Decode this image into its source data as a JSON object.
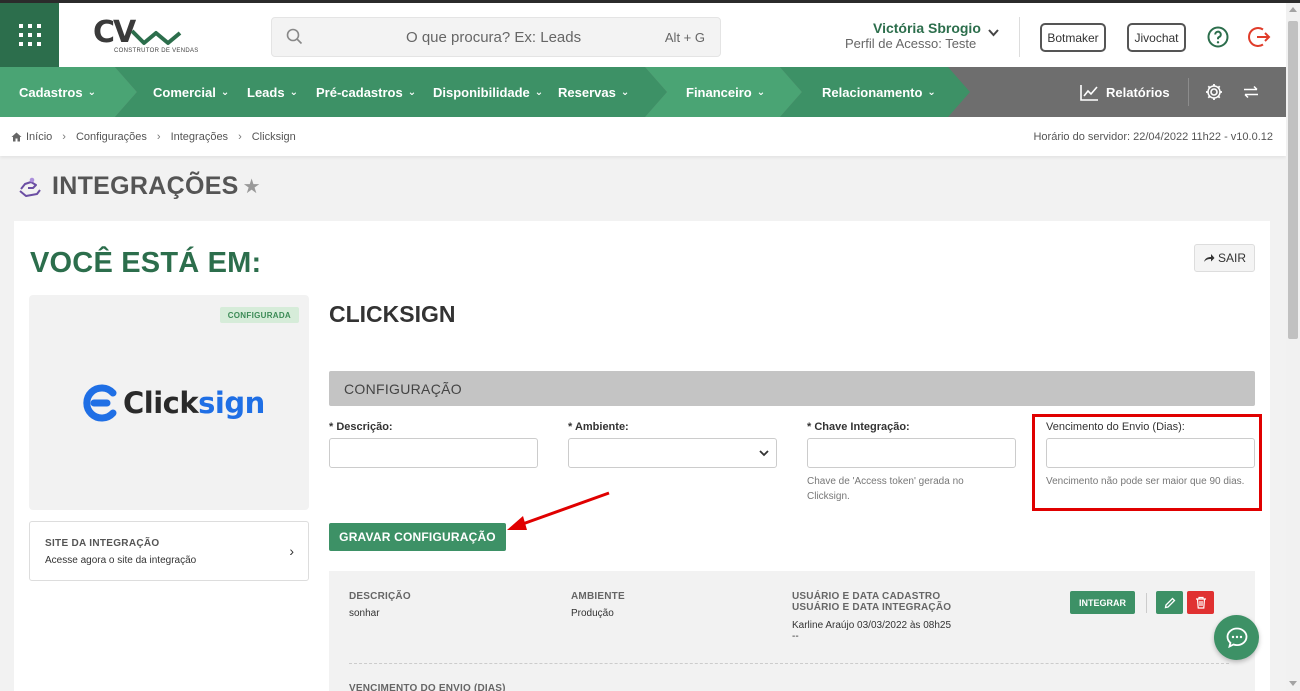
{
  "header": {
    "logo": {
      "text": "CV",
      "subtitle": "CONSTRUTOR DE VENDAS"
    },
    "search": {
      "placeholder": "O que procura? Ex: Leads",
      "shortcut": "Alt + G"
    },
    "user": {
      "name": "Victória Sbrogio",
      "profile": "Perfil de Acesso: Teste"
    },
    "buttons": {
      "botmaker": "Botmaker",
      "jivochat": "Jivochat"
    },
    "icons": [
      "grid-menu-icon",
      "search-icon",
      "chevron-down-icon",
      "help-icon",
      "logout-icon"
    ]
  },
  "nav": {
    "items": [
      "Cadastros",
      "Comercial",
      "Leads",
      "Pré-cadastros",
      "Disponibilidade",
      "Reservas",
      "Financeiro",
      "Relacionamento"
    ],
    "reports": "Relatórios",
    "colors": {
      "primary": "#2c6e4c",
      "green": "#3d9166",
      "light_green": "#4aa474",
      "gray": "#6e6e6e"
    }
  },
  "breadcrumb": {
    "items": [
      "Início",
      "Configurações",
      "Integrações",
      "Clicksign"
    ],
    "server_time": "Horário do servidor: 22/04/2022 11h22 - v10.0.12"
  },
  "page": {
    "title": "INTEGRAÇÕES"
  },
  "main": {
    "you_are_in": "VOCÊ ESTÁ EM:",
    "exit_label": "SAIR",
    "badge": "CONFIGURADA",
    "integration_logo": "Clicksign",
    "site": {
      "title": "SITE DA INTEGRAÇÃO",
      "desc": "Acesse agora o site da integração"
    },
    "integration_name": "CLICKSIGN",
    "section_title": "CONFIGURAÇÃO",
    "fields": {
      "descricao": {
        "label": "Descrição:",
        "required": "*",
        "value": ""
      },
      "ambiente": {
        "label": "Ambiente:",
        "required": "*",
        "value": ""
      },
      "chave": {
        "label": "Chave Integração:",
        "required": "*",
        "value": "",
        "help": "Chave de 'Access token' gerada no Clicksign."
      },
      "vencimento": {
        "label": "Vencimento do Envio (Dias):",
        "value": "",
        "help": "Vencimento não pode ser maior que 90 dias."
      }
    },
    "save_button": "GRAVAR CONFIGURAÇÃO",
    "list": {
      "headers": {
        "descricao": "DESCRIÇÃO",
        "ambiente": "AMBIENTE",
        "usuario_cadastro": "USUÁRIO E DATA CADASTRO",
        "usuario_integracao": "USUÁRIO E DATA INTEGRAÇÃO",
        "vencimento": "VENCIMENTO DO ENVIO (DIAS)"
      },
      "row": {
        "descricao": "sonhar",
        "ambiente": "Produção",
        "cadastro": "Karline Araújo 03/03/2022 às 08h25",
        "integracao": "--"
      },
      "integrate_button": "INTEGRAR"
    }
  }
}
